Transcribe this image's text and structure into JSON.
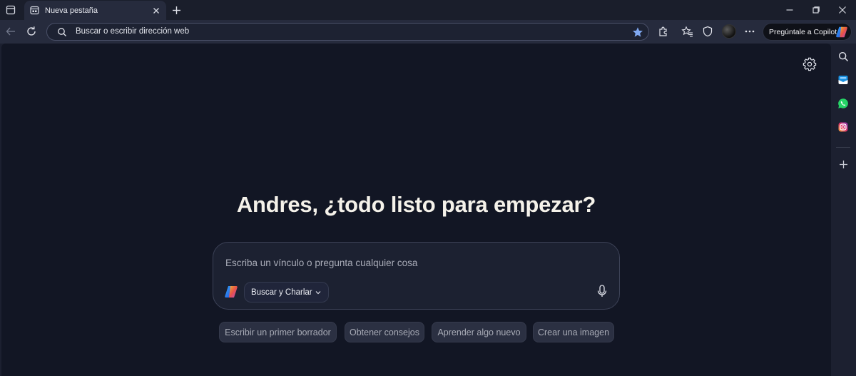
{
  "tab": {
    "title": "Nueva pestaña"
  },
  "address_bar": {
    "placeholder": "Buscar o escribir dirección web"
  },
  "copilot_button": {
    "label": "Pregúntale a Copilot"
  },
  "main": {
    "headline": "Andres, ¿todo listo para empezar?",
    "search": {
      "placeholder": "Escriba un vínculo o pregunta cualquier cosa",
      "mode_label": "Buscar y Charlar"
    },
    "suggestions": [
      "Escribir un primer borrador",
      "Obtener consejos",
      "Aprender algo nuevo",
      "Crear una imagen"
    ]
  },
  "colors": {
    "content_background": "#121624",
    "chrome_background": "#262b3d",
    "headline_text": "#f5f2ea",
    "favorite_star": "#7fa8f0"
  },
  "icons": {
    "tab_actions": "tab-actions-icon",
    "tab_favicon": "newtab-icon",
    "back": "back-arrow-icon",
    "refresh": "refresh-icon",
    "extensions": "puzzle-icon",
    "favorites": "favorites-icon",
    "browser_essentials": "shield-icon",
    "more": "more-icon",
    "settings": "gear-icon",
    "sidebar": [
      "search-icon",
      "outlook-icon",
      "whatsapp-icon",
      "instagram-icon",
      "plus-icon"
    ]
  }
}
